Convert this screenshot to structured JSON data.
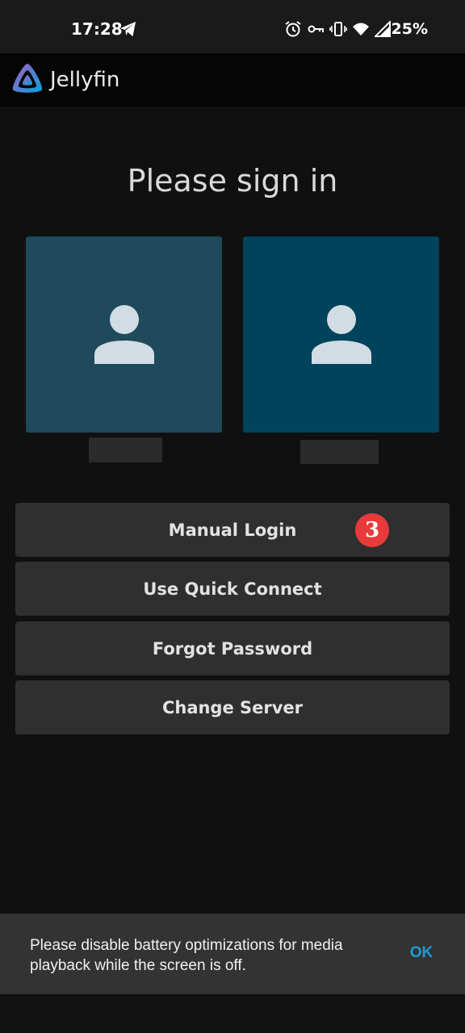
{
  "status_bar": {
    "time": "17:28",
    "battery": "25%",
    "icons": [
      "telegram-icon",
      "alarm-icon",
      "vpn-key-icon",
      "vibrate-icon",
      "wifi-icon",
      "signal-icon"
    ]
  },
  "app_bar": {
    "title": "Jellyfin",
    "logo_icon": "jellyfin-logo-icon"
  },
  "page": {
    "title": "Please sign in"
  },
  "users": [
    {
      "icon": "person-icon",
      "color": "#1e4a5c",
      "name": ""
    },
    {
      "icon": "person-icon",
      "color": "#00435c",
      "name": ""
    }
  ],
  "buttons": {
    "manual_login": "Manual Login",
    "quick_connect": "Use Quick Connect",
    "forgot_password": "Forgot Password",
    "change_server": "Change Server"
  },
  "step_badge": "3",
  "snackbar": {
    "message": "Please disable battery optimizations for media playback while the screen is off.",
    "action": "OK",
    "action_color": "#1e9bd7"
  }
}
